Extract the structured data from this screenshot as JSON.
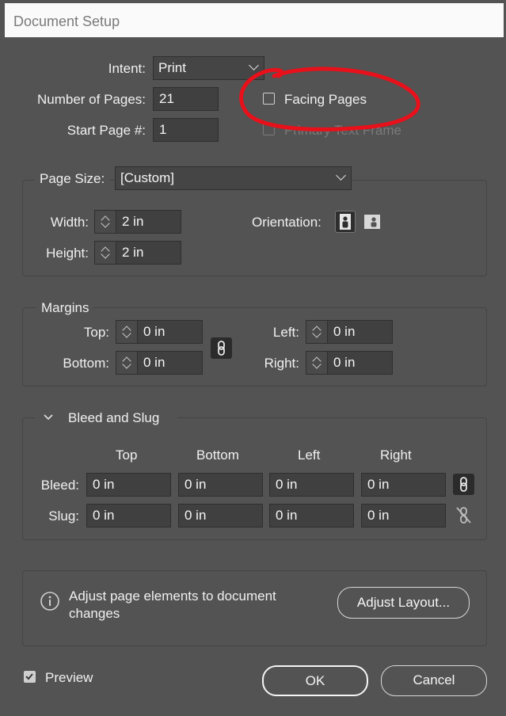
{
  "window": {
    "title": "Document Setup"
  },
  "top": {
    "intent_label": "Intent:",
    "intent_value": "Print",
    "pages_label": "Number of Pages:",
    "pages_value": "21",
    "start_label": "Start Page #:",
    "start_value": "1",
    "facing_pages_label": "Facing Pages",
    "facing_pages_checked": false,
    "primary_text_frame_label": "Primary Text Frame",
    "primary_text_frame_enabled": false
  },
  "page_size": {
    "label": "Page Size:",
    "value": "[Custom]",
    "width_label": "Width:",
    "width_value": "2 in",
    "height_label": "Height:",
    "height_value": "2 in",
    "orientation_label": "Orientation:",
    "orientation_selected": "portrait"
  },
  "margins": {
    "title": "Margins",
    "top_label": "Top:",
    "top_value": "0 in",
    "bottom_label": "Bottom:",
    "bottom_value": "0 in",
    "left_label": "Left:",
    "left_value": "0 in",
    "right_label": "Right:",
    "right_value": "0 in",
    "linked": true
  },
  "bleed_slug": {
    "title": "Bleed and Slug",
    "columns": [
      "Top",
      "Bottom",
      "Left",
      "Right"
    ],
    "bleed_label": "Bleed:",
    "bleed_values": [
      "0 in",
      "0 in",
      "0 in",
      "0 in"
    ],
    "bleed_linked": true,
    "slug_label": "Slug:",
    "slug_values": [
      "0 in",
      "0 in",
      "0 in",
      "0 in"
    ],
    "slug_linked": false
  },
  "adjust": {
    "info_line1": "Adjust page elements to document",
    "info_line2": "changes",
    "button": "Adjust Layout..."
  },
  "footer": {
    "preview_label": "Preview",
    "preview_checked": true,
    "ok": "OK",
    "cancel": "Cancel"
  },
  "colors": {
    "dialog_bg": "#535353",
    "field_bg": "#404040",
    "annotation_red": "#e8101a"
  },
  "icons": [
    "chevron-down-icon",
    "portrait-orientation-icon",
    "landscape-orientation-icon",
    "link-icon",
    "unlink-icon",
    "info-icon",
    "checkbox-checked-icon"
  ]
}
